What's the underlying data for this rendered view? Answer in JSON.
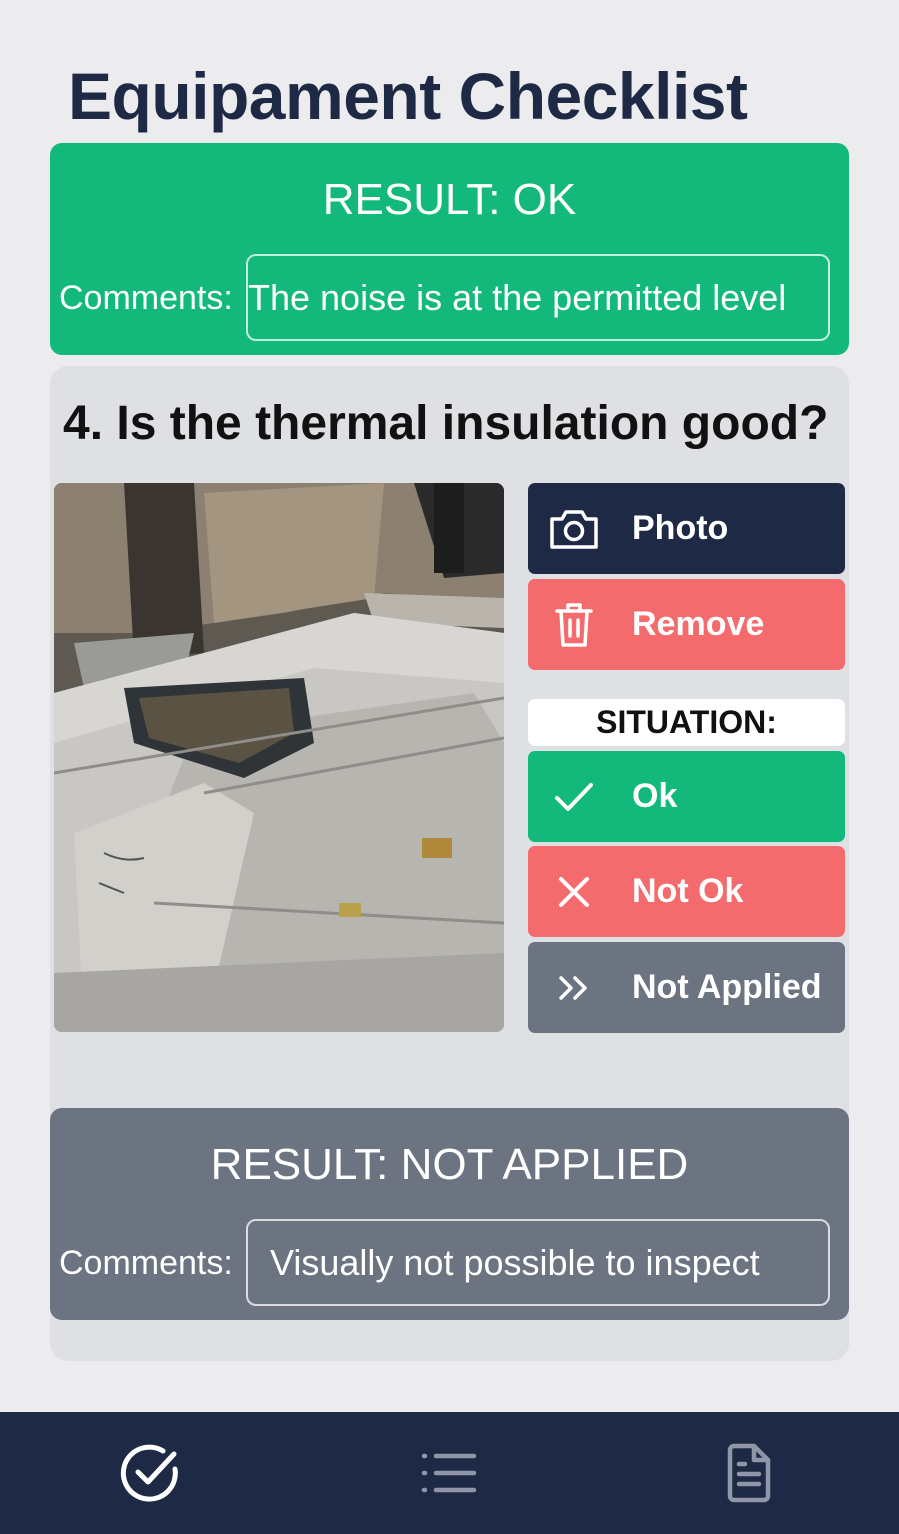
{
  "header": {
    "title": "Equipament Checklist"
  },
  "previous_result": {
    "result_text": "RESULT: OK",
    "status": "ok",
    "comments_label": "Comments:",
    "comments_value": "The noise is at the permitted level",
    "color": "#12b97b"
  },
  "question": {
    "title": "4. Is the thermal insulation good?",
    "photo": {
      "icon": "duct-insulation-photo"
    },
    "actions": {
      "photo_label": "Photo",
      "remove_label": "Remove"
    },
    "situation_label": "SITUATION:",
    "options": {
      "ok_label": "Ok",
      "not_ok_label": "Not Ok",
      "not_applied_label": "Not Applied"
    },
    "result": {
      "result_text": "RESULT: NOT APPLIED",
      "status": "not_applied",
      "comments_label": "Comments:",
      "comments_value": "Visually not possible to inspect",
      "color": "#6c7381"
    }
  },
  "bottom_nav": {
    "items": [
      {
        "icon": "check-circle-icon"
      },
      {
        "icon": "list-icon"
      },
      {
        "icon": "document-icon"
      }
    ]
  },
  "colors": {
    "navy": "#1e2a45",
    "green": "#12b97b",
    "red": "#f46b6e",
    "gray": "#6c7381",
    "page_bg": "#ececee",
    "card_bg": "#dfe0e4"
  }
}
